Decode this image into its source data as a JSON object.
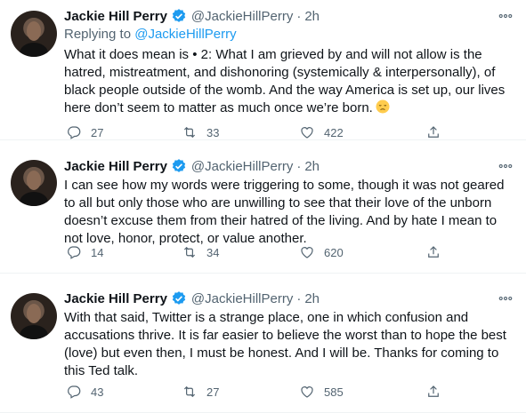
{
  "tweets": [
    {
      "name": "Jackie Hill Perry",
      "handle": "@JackieHillPerry",
      "dot": "·",
      "time": "2h",
      "replying_prefix": "Replying to",
      "replying_handle": "@JackieHillPerry",
      "text": "What it does mean is • 2: What I am grieved by and will not allow is the hatred, mistreatment, and dishonoring (systemically & interpersonally), of black people outside of the womb. And the way America is set up, our lives here don’t seem to matter as much once we’re born.",
      "replies": "27",
      "retweets": "33",
      "likes": "422"
    },
    {
      "name": "Jackie Hill Perry",
      "handle": "@JackieHillPerry",
      "dot": "·",
      "time": "2h",
      "text": "I can see how my words were triggering to some, though it was not geared to all but only those who are unwilling to see that their love of the unborn doesn’t excuse them from their hatred of the living. And by hate I mean to not love, honor, protect, or value another.",
      "replies": "14",
      "retweets": "34",
      "likes": "620"
    },
    {
      "name": "Jackie Hill Perry",
      "handle": "@JackieHillPerry",
      "dot": "·",
      "time": "2h",
      "text": "With that said, Twitter is a strange place, one in which confusion and accusations thrive. It is far easier to believe the worst than to hope the best (love) but even then, I must be honest. And I will be. Thanks for coming to this Ted talk.",
      "replies": "43",
      "retweets": "27",
      "likes": "585"
    }
  ],
  "icons": {
    "verified": "verified-badge-icon",
    "more": "more-icon",
    "reply": "reply-icon",
    "retweet": "retweet-icon",
    "like": "like-icon",
    "share": "share-icon",
    "emoji": "pensive-face-emoji"
  },
  "colors": {
    "accent": "#1d9bf0",
    "secondary_text": "#536471",
    "text": "#0f1419"
  }
}
